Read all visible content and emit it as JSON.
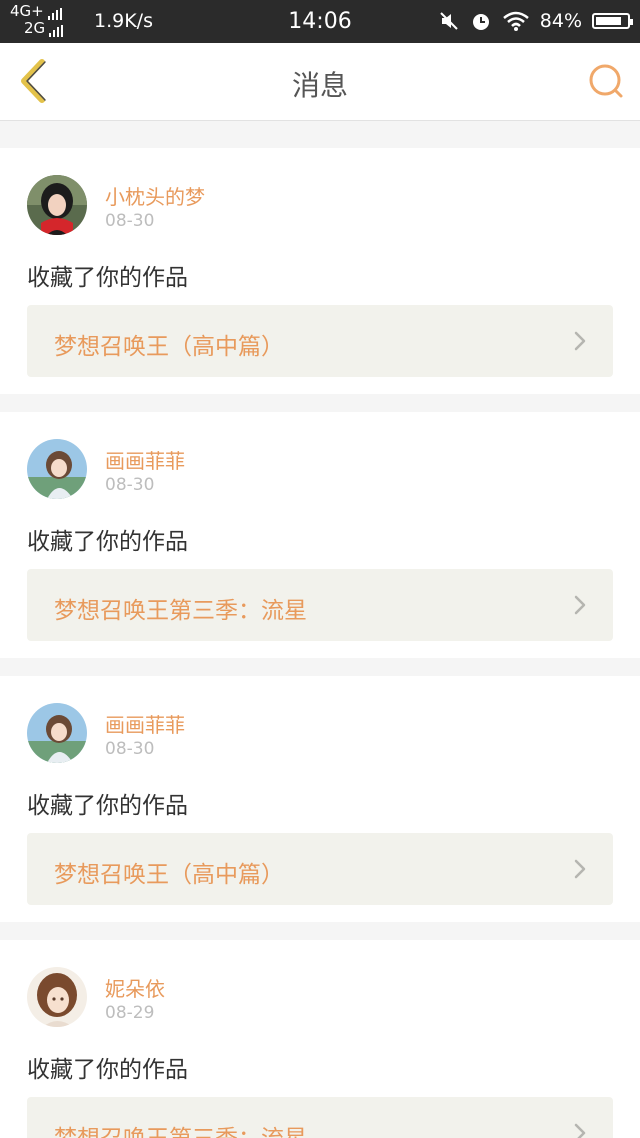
{
  "status_bar": {
    "network_top": "4G+",
    "network_bottom": "2G",
    "speed": "1.9K/s",
    "time": "14:06",
    "battery_percent": "84%",
    "battery_level": 0.84,
    "icons": [
      "mute-icon",
      "alarm-icon",
      "wifi-icon",
      "battery-icon"
    ]
  },
  "header": {
    "title": "消息",
    "back_icon": "back-chevron-icon",
    "search_icon": "search-icon",
    "accent_color": "#e89a5c",
    "back_color": "#e3c24a"
  },
  "messages": [
    {
      "user": "小枕头的梦",
      "date": "08-30",
      "action": "收藏了你的作品",
      "work": "梦想召唤王（高中篇）",
      "avatar": "avatar-girl-red-scarf"
    },
    {
      "user": "画画菲菲",
      "date": "08-30",
      "action": "收藏了你的作品",
      "work": "梦想召唤王第三季：流星",
      "avatar": "avatar-anime-girl-sky"
    },
    {
      "user": "画画菲菲",
      "date": "08-30",
      "action": "收藏了你的作品",
      "work": "梦想召唤王（高中篇）",
      "avatar": "avatar-anime-girl-sky"
    },
    {
      "user": "妮朵依",
      "date": "08-29",
      "action": "收藏了你的作品",
      "work": "梦想召唤王第三季：流星",
      "avatar": "avatar-anime-girl-brown-hair"
    }
  ]
}
